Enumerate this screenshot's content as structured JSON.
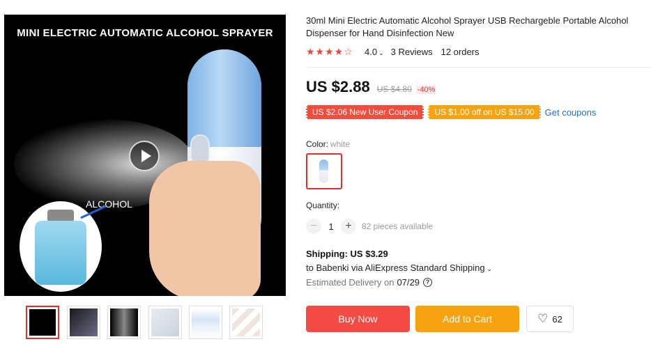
{
  "gallery": {
    "main_image_title": "MINI ELECTRIC AUTOMATIC ALCOHOL SPRAYER",
    "main_image_label": "ALCOHOL",
    "thumbnail_count": 6,
    "selected_thumbnail": 1
  },
  "product": {
    "title": "30ml Mini Electric Automatic Alcohol Sprayer USB Rechargeble Portable Alcohol Dispenser for Hand Disinfection New",
    "rating": 4.0,
    "rating_text": "4.0",
    "reviews_text": "3 Reviews",
    "orders_text": "12 orders"
  },
  "price": {
    "current": "US $2.88",
    "original": "US $4.80",
    "discount": "-40%"
  },
  "coupons": {
    "new_user": "US $2.06 New User Coupon",
    "store": "US $1.00 off on US $15.00",
    "get_link": "Get coupons"
  },
  "options": {
    "color_label": "Color:",
    "color_value": "white",
    "quantity_label": "Quantity:",
    "quantity_value": "1",
    "available_text": "82 pieces available"
  },
  "shipping": {
    "title": "Shipping: US $3.29",
    "to_text": "to Babenki via AliExpress Standard Shipping",
    "delivery_label": "Estimated Delivery on",
    "delivery_date": "07/29"
  },
  "actions": {
    "buy_now": "Buy Now",
    "add_to_cart": "Add to Cart",
    "wishlist_count": "62"
  },
  "colors": {
    "accent_red": "#f54b45",
    "accent_orange": "#f7a310",
    "link_blue": "#2272c8",
    "star_red": "#e64a3b"
  }
}
